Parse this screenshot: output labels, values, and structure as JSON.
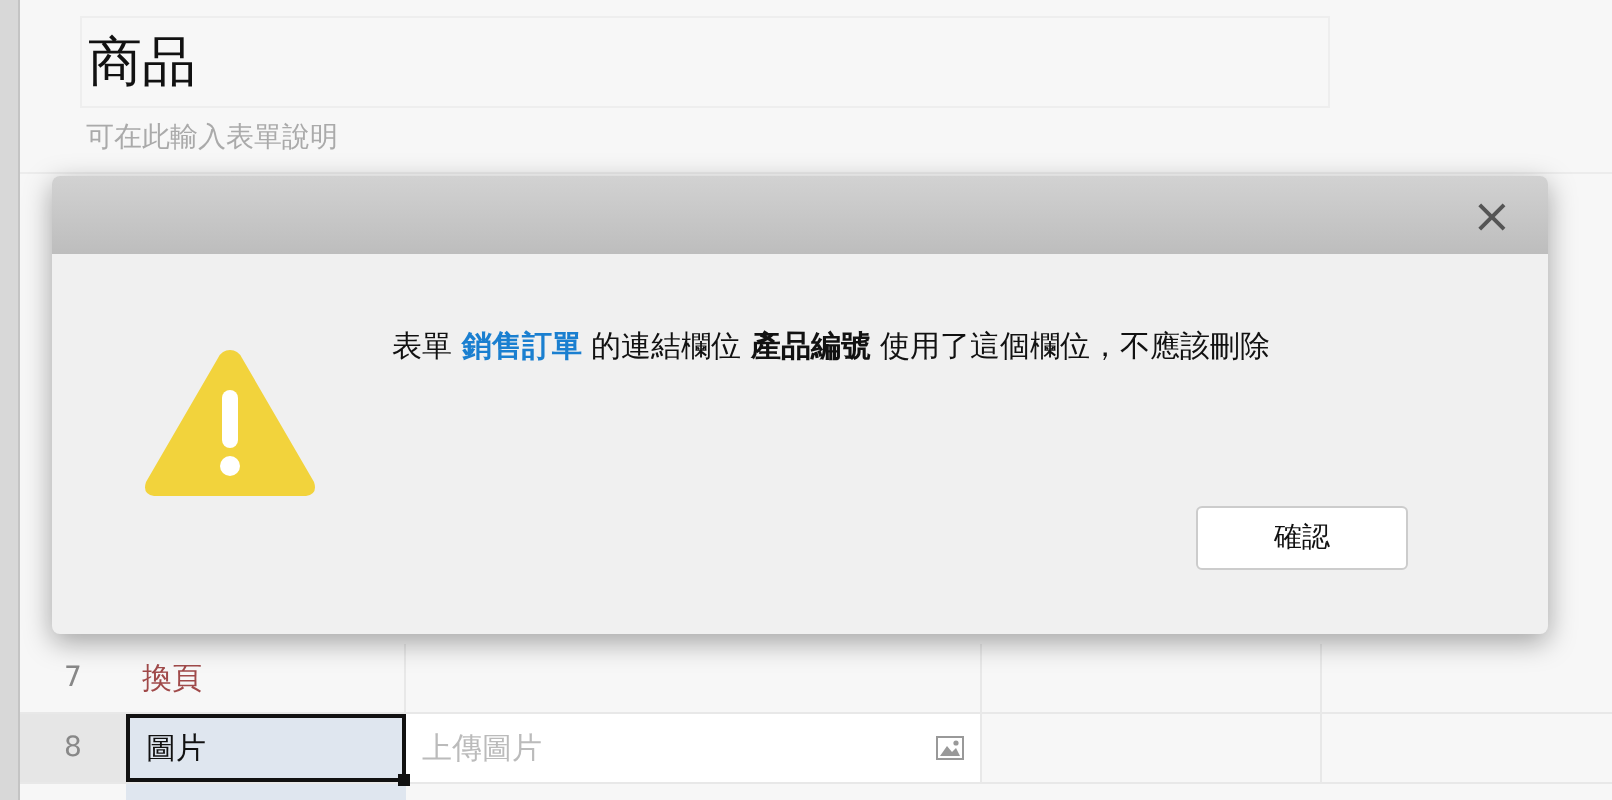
{
  "form": {
    "title": "商品",
    "description_placeholder": "可在此輸入表單說明"
  },
  "rows": [
    {
      "number": "7",
      "label": "換頁",
      "kind": "page_break",
      "selected": false
    },
    {
      "number": "8",
      "label": "圖片",
      "kind": "image",
      "placeholder": "上傳圖片",
      "selected": true
    }
  ],
  "dialog": {
    "close": "×",
    "message": [
      {
        "kind": "plain",
        "text": "表單 "
      },
      {
        "kind": "link",
        "text": "銷售訂單"
      },
      {
        "kind": "plain",
        "text": " 的連結欄位 "
      },
      {
        "kind": "bold",
        "text": "產品編號"
      },
      {
        "kind": "plain",
        "text": " 使用了這個欄位，不應該刪除"
      }
    ],
    "buttons": [
      "確認"
    ]
  }
}
